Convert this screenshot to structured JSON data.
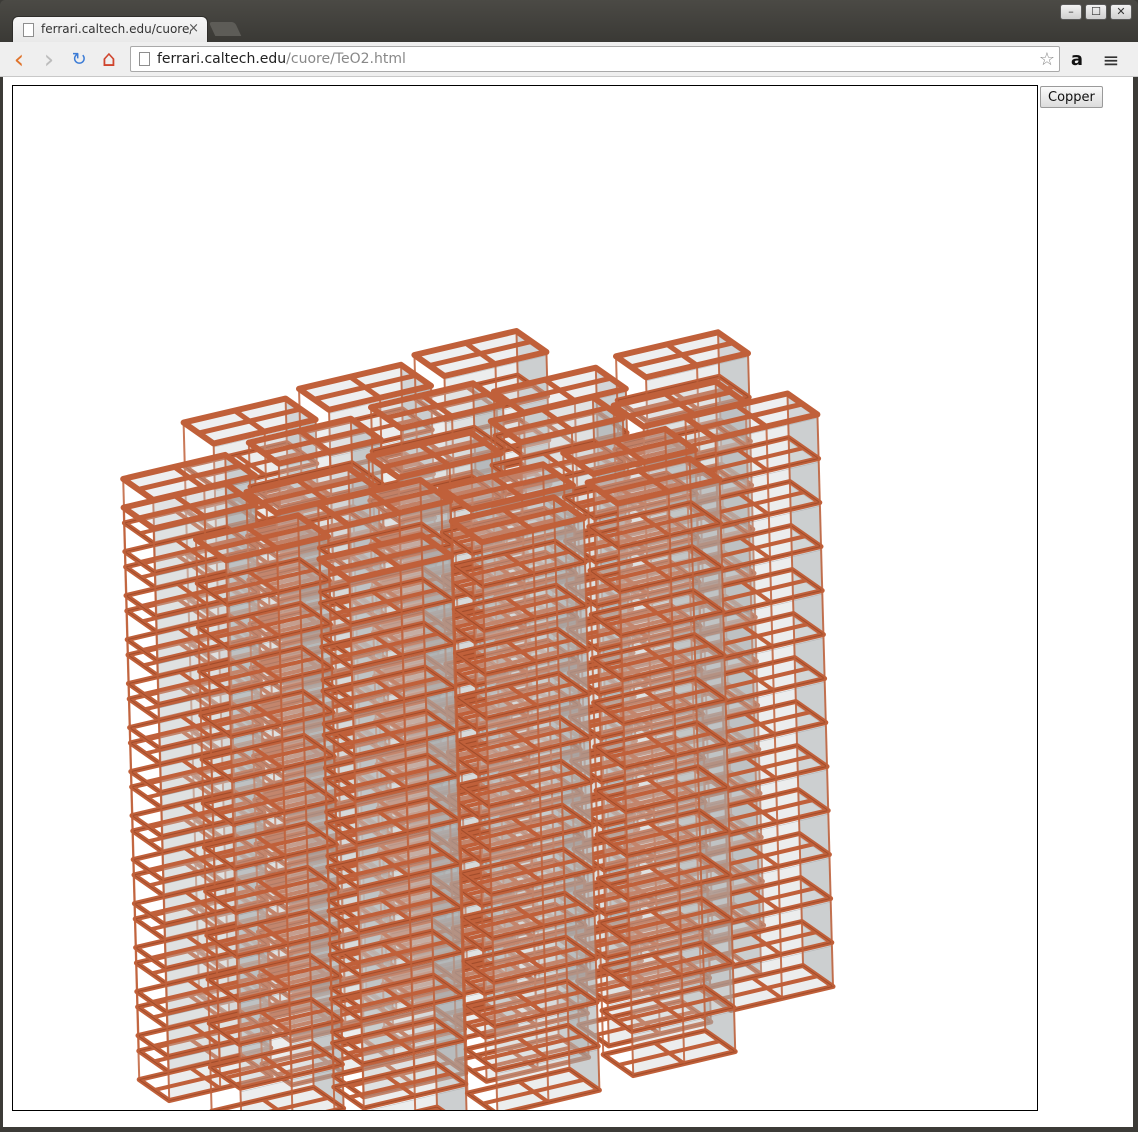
{
  "browser": {
    "tab_title": "ferrari.caltech.edu/cuore/TeO2.html",
    "tab_close": "×",
    "window_controls": {
      "minimize": "–",
      "maximize": "☐",
      "close": "✕"
    },
    "nav": {
      "back": "‹",
      "forward": "›",
      "reload": "↻",
      "home": "⌂"
    },
    "url_host": "ferrari.caltech.edu",
    "url_path": "/cuore/TeO2.html",
    "star": "☆",
    "amazon": "a",
    "menu": "≡"
  },
  "page": {
    "button_label": "Copper"
  },
  "scene": {
    "copper_color": "#c0603a",
    "copper_dark": "#8c3f22",
    "crystal_fill": "#c8cacc",
    "crystal_edge": "#8f9396"
  }
}
